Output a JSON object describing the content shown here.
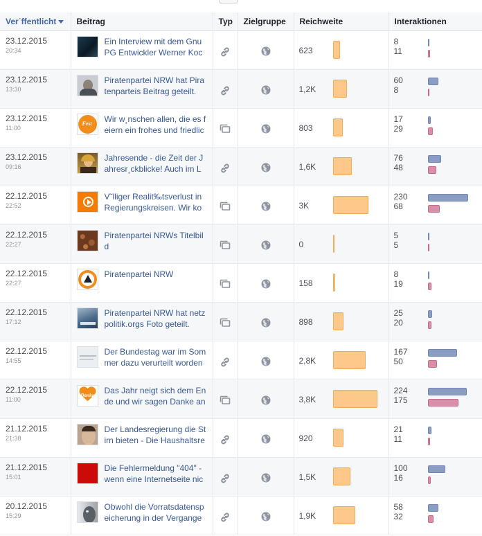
{
  "headers": {
    "date": "Ver˙ffentlicht",
    "post": "Beitrag",
    "type": "Typ",
    "target": "Zielgruppe",
    "reach": "Reichweite",
    "interactions": "Interaktionen"
  },
  "colors": {
    "reach_bar": "#fcc98a",
    "interaction_bar_a": "#8b9dc3",
    "interaction_bar_b": "#d88fa9",
    "link": "#365899",
    "sorted_header": "#4267b2"
  },
  "rows": [
    {
      "date": "23.12.2015",
      "time": "20:34",
      "text": "Ein Interview mit dem Gnu PG Entwickler Werner Koc",
      "type_icon": "link-icon",
      "target_icon": "globe-icon",
      "reach": "623",
      "reach_value": 623,
      "inter_a": "8",
      "inter_b": "11",
      "thumb": "dark-photo"
    },
    {
      "date": "23.12.2015",
      "time": "13:30",
      "text": "Piratenpartei NRW hat Pira tenparteis Beitrag geteilt.",
      "type_icon": "link-icon",
      "target_icon": "globe-icon",
      "reach": "1,2K",
      "reach_value": 1200,
      "inter_a": "60",
      "inter_b": "8",
      "thumb": "person-photo"
    },
    {
      "date": "23.12.2015",
      "time": "11:00",
      "text": "Wir w¸nschen allen, die es f eiern ein frohes und friedlic",
      "type_icon": "photo-icon",
      "target_icon": "globe-icon",
      "reach": "803",
      "reach_value": 803,
      "inter_a": "17",
      "inter_b": "29",
      "thumb": "orange-circle"
    },
    {
      "date": "23.12.2015",
      "time": "09:16",
      "text": "Jahresende - die Zeit der J ahresr¸ckblicke! Auch im L",
      "type_icon": "link-icon",
      "target_icon": "globe-icon",
      "reach": "1,6K",
      "reach_value": 1600,
      "inter_a": "76",
      "inter_b": "48",
      "thumb": "speaker-photo"
    },
    {
      "date": "22.12.2015",
      "time": "22:52",
      "text": "V˜lliger Realit‰tsverlust in Regierungskreisen. Wir ko",
      "type_icon": "photo-icon",
      "target_icon": "globe-icon",
      "reach": "3K",
      "reach_value": 3000,
      "inter_a": "230",
      "inter_b": "68",
      "thumb": "orange-play"
    },
    {
      "date": "22.12.2015",
      "time": "22:27",
      "text": "Piratenpartei NRWs Titelbil d",
      "type_icon": "photo-icon",
      "target_icon": "globe-icon",
      "reach": "0",
      "reach_value": 0,
      "inter_a": "5",
      "inter_b": "5",
      "thumb": "brown-texture"
    },
    {
      "date": "22.12.2015",
      "time": "22:27",
      "text": "Piratenpartei NRW",
      "type_icon": "photo-icon",
      "target_icon": "globe-icon",
      "reach": "158",
      "reach_value": 158,
      "inter_a": "8",
      "inter_b": "19",
      "thumb": "pirate-logo"
    },
    {
      "date": "22.12.2015",
      "time": "17:12",
      "text": "Piratenpartei NRW hat netz politik.orgs Foto geteilt.",
      "type_icon": "photo-icon",
      "target_icon": "globe-icon",
      "reach": "898",
      "reach_value": 898,
      "inter_a": "25",
      "inter_b": "20",
      "thumb": "blue-photo"
    },
    {
      "date": "22.12.2015",
      "time": "14:55",
      "text": "Der Bundestag war im Som mer dazu verurteilt worden",
      "type_icon": "link-icon",
      "target_icon": "globe-icon",
      "reach": "2,8K",
      "reach_value": 2800,
      "inter_a": "167",
      "inter_b": "50",
      "thumb": "paper-photo"
    },
    {
      "date": "22.12.2015",
      "time": "11:00",
      "text": "Das Jahr neigt sich dem En de und wir sagen Danke an",
      "type_icon": "photo-icon",
      "target_icon": "globe-icon",
      "reach": "3,8K",
      "reach_value": 3800,
      "inter_a": "224",
      "inter_b": "175",
      "thumb": "danke-heart"
    },
    {
      "date": "21.12.2015",
      "time": "21:38",
      "text": "Der Landesregierung die St irn bieten - Die Haushaltsre",
      "type_icon": "link-icon",
      "target_icon": "globe-icon",
      "reach": "920",
      "reach_value": 920,
      "inter_a": "21",
      "inter_b": "11",
      "thumb": "face-photo"
    },
    {
      "date": "21.12.2015",
      "time": "15:01",
      "text": "Die Fehlermeldung \"404\" - wenn eine Internetseite nic",
      "type_icon": "link-icon",
      "target_icon": "globe-icon",
      "reach": "1,5K",
      "reach_value": 1500,
      "inter_a": "100",
      "inter_b": "16",
      "thumb": "red-square"
    },
    {
      "date": "20.12.2015",
      "time": "15:29",
      "text": "Obwohl die Vorratsdatensp eicherung in der Vergange",
      "type_icon": "link-icon",
      "target_icon": "globe-icon",
      "reach": "1,9K",
      "reach_value": 1900,
      "inter_a": "58",
      "inter_b": "32",
      "thumb": "bw-face"
    }
  ]
}
